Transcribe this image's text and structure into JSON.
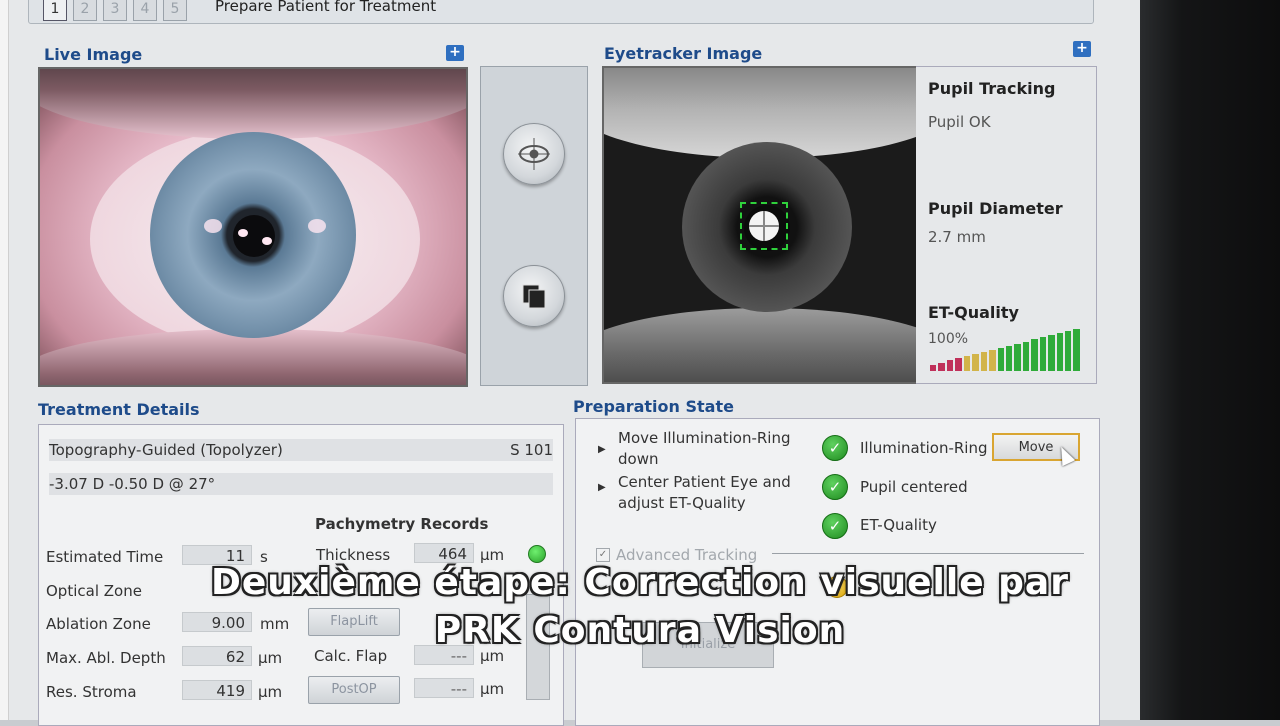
{
  "header": {
    "steps": [
      "1",
      "2",
      "3",
      "4",
      "5"
    ],
    "title": "Prepare Patient for Treatment"
  },
  "live": {
    "title": "Live Image",
    "expand": "+"
  },
  "eyetracker": {
    "title": "Eyetracker Image",
    "expand": "+",
    "pupil_tracking_label": "Pupil Tracking",
    "pupil_tracking_value": "Pupil OK",
    "pupil_diameter_label": "Pupil Diameter",
    "pupil_diameter_value": "2.7 mm",
    "et_quality_label": "ET-Quality",
    "et_quality_value": "100%",
    "quality_levels": [
      0.15,
      0.2,
      0.25,
      0.3,
      0.35,
      0.4,
      0.45,
      0.5,
      0.55,
      0.6,
      0.65,
      0.7,
      0.75,
      0.8,
      0.85,
      0.9,
      0.95,
      1.0
    ],
    "quality_colors": [
      "#c0305a",
      "#c0305a",
      "#c0305a",
      "#c0305a",
      "#d2b44a",
      "#d2b44a",
      "#d2b44a",
      "#d2b44a",
      "#2fab3a",
      "#2fab3a",
      "#2fab3a",
      "#2fab3a",
      "#2fab3a",
      "#2fab3a",
      "#2fab3a",
      "#2fab3a",
      "#2fab3a",
      "#2fab3a"
    ]
  },
  "treatment": {
    "title": "Treatment Details",
    "mode": "Topography-Guided (Topolyzer)",
    "mode_code": "S 101",
    "refraction": "-3.07 D -0.50 D @ 27°",
    "pachy_title": "Pachymetry Records",
    "estimated_time_label": "Estimated Time",
    "estimated_time_value": "11",
    "estimated_time_unit": "s",
    "optical_zone_label": "Optical Zone",
    "ablation_zone_label": "Ablation Zone",
    "ablation_zone_value": "9.00",
    "ablation_zone_unit": "mm",
    "max_abl_label": "Max. Abl. Depth",
    "max_abl_value": "62",
    "max_abl_unit": "µm",
    "res_stroma_label": "Res. Stroma",
    "res_stroma_value": "419",
    "res_stroma_unit": "µm",
    "thickness_label": "Thickness",
    "thickness_value": "464",
    "thickness_unit": "µm",
    "flaplift_btn": "FlapLift",
    "calc_flap_label": "Calc. Flap",
    "calc_flap_value": "---",
    "calc_flap_unit": "µm",
    "postop_btn": "PostOP",
    "postop_value": "---",
    "postop_unit": "µm"
  },
  "prep": {
    "title": "Preparation State",
    "instr1": "Move Illumination-Ring down",
    "instr2": "Center Patient Eye and adjust ET-Quality",
    "check1": "Illumination-Ring",
    "check2": "Pupil centered",
    "check3": "ET-Quality",
    "check_mark": "✓",
    "move_btn": "Move",
    "advanced": "Advanced Tracking",
    "initialize_btn": "Initialize"
  },
  "caption": {
    "line1": "Deuxième étape: Correction visuelle par",
    "line2": "PRK Contura Vision"
  }
}
